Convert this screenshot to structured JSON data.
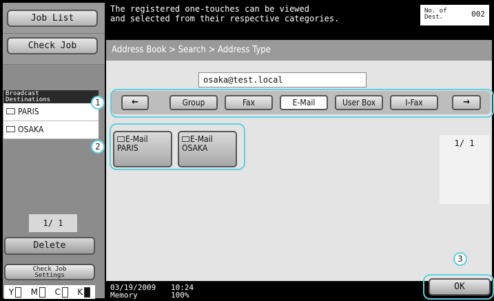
{
  "left_panel": {
    "job_list_label": "Job List",
    "check_job_label": "Check Job",
    "broadcast_header": "Broadcast\nDestinations",
    "destinations": [
      "PARIS",
      "OSAKA"
    ],
    "page_indicator": "1/ 1",
    "delete_label": "Delete",
    "check_job_settings_label": "Check Job\nSettings",
    "toner": [
      {
        "letter": "Y",
        "color": "#ffffff"
      },
      {
        "letter": "M",
        "color": "#ffffff"
      },
      {
        "letter": "C",
        "color": "#ffffff"
      },
      {
        "letter": "K",
        "color": "#111111"
      }
    ]
  },
  "header": {
    "message": "The registered one-touches can be viewed\nand selected from their respective categories.",
    "dest_count_label": "No. of\nDest.",
    "dest_count_value": "002"
  },
  "main": {
    "breadcrumb": "Address Book > Search > Address Type",
    "search_value": "osaka@test.local",
    "categories": [
      "Group",
      "Fax",
      "E-Mail",
      "User Box",
      "I-Fax"
    ],
    "selected_category": "E-Mail",
    "prev_arrow": "←",
    "next_arrow": "→",
    "addresses": [
      {
        "type": "E-Mail",
        "name": "PARIS"
      },
      {
        "type": "E-Mail",
        "name": "OSAKA"
      }
    ],
    "page_indicator": "1/ 1"
  },
  "footer": {
    "date": "03/19/2009",
    "time": "10:24",
    "memory_label": "Memory",
    "memory_value": "100%",
    "ok_label": "OK"
  },
  "callouts": [
    "1",
    "2",
    "3"
  ],
  "colors": {
    "callout": "#5fd0e0",
    "background": "#000000",
    "panel": "#e4e4e4"
  }
}
